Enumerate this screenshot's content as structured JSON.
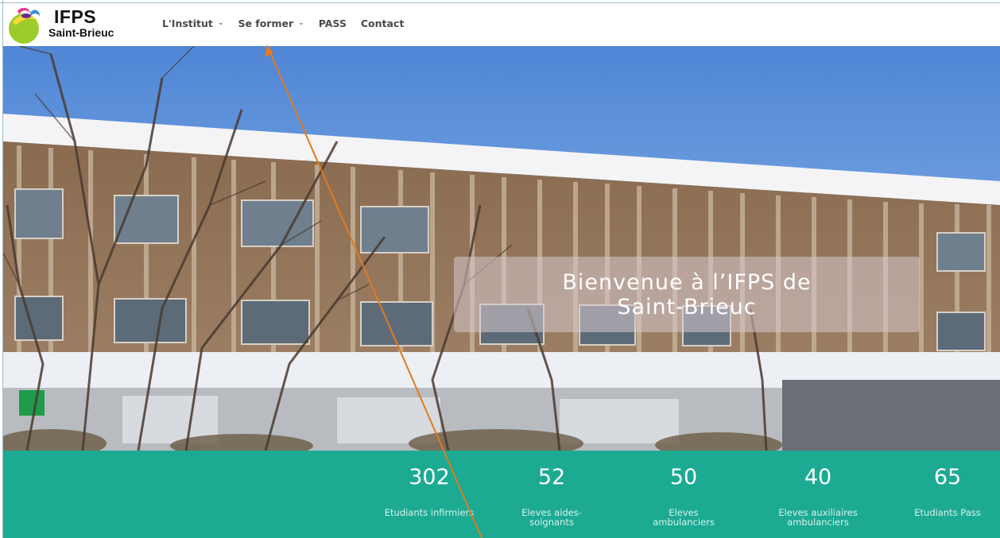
{
  "brand": {
    "title": "IFPS",
    "subtitle": "Saint-Brieuc"
  },
  "nav": {
    "items": [
      {
        "label": "L'Institut",
        "has_dropdown": true
      },
      {
        "label": "Se former",
        "has_dropdown": true
      },
      {
        "label": "PASS",
        "has_dropdown": false
      },
      {
        "label": "Contact",
        "has_dropdown": false
      }
    ]
  },
  "hero": {
    "welcome_line1": "Bienvenue à l’IFPS de",
    "welcome_line2": "Saint-Brieuc"
  },
  "stats": [
    {
      "value": "302",
      "label": "Etudiants infirmiers"
    },
    {
      "value": "52",
      "label": "Eleves aides-soignants"
    },
    {
      "value": "50",
      "label": "Eleves ambulanciers"
    },
    {
      "value": "40",
      "label": "Eleves auxiliaires ambulanciers"
    },
    {
      "value": "65",
      "label": "Etudiants Pass"
    }
  ],
  "colors": {
    "accent_teal": "#1caa93",
    "annotation_arrow": "#e07b1f",
    "sky": "#6e9fd9"
  },
  "icons": {
    "dropdown": "chevron-down-icon",
    "logo": "logo-mark-icon"
  }
}
